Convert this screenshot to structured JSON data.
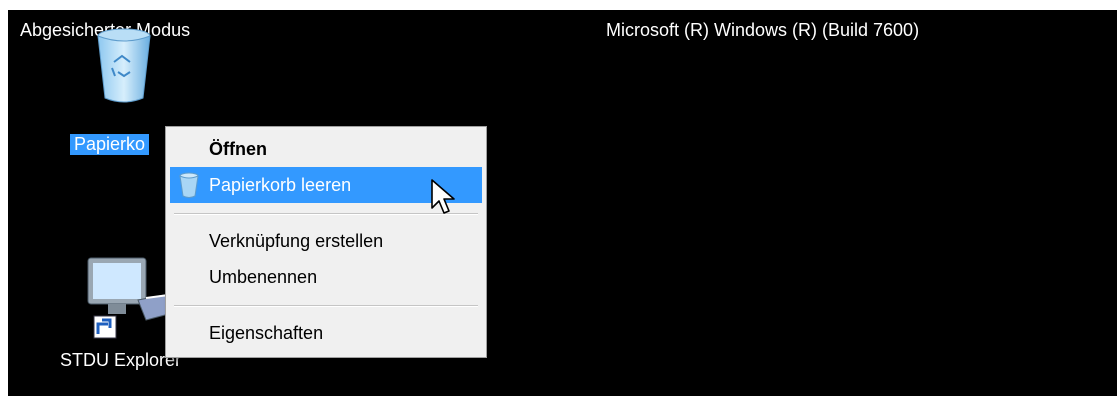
{
  "desktop": {
    "mode_label": "Abgesicherter Modus",
    "build_label": "Microsoft (R) Windows (R) (Build 7600)",
    "background_color": "#000000"
  },
  "icons": [
    {
      "label": "Papierko",
      "icon": "recycle-bin-icon",
      "selected": true
    },
    {
      "label": "STDU Explorer",
      "icon": "computer-shortcut-icon",
      "selected": false
    }
  ],
  "context_menu": {
    "items": [
      {
        "label": "Öffnen",
        "bold": true
      },
      {
        "label": "Papierkorb leeren",
        "highlighted": true,
        "icon": "recycle-bin-icon"
      },
      {
        "label": "Verknüpfung erstellen"
      },
      {
        "label": "Umbenennen"
      },
      {
        "label": "Eigenschaften"
      }
    ],
    "highlight_color": "#3399ff"
  }
}
